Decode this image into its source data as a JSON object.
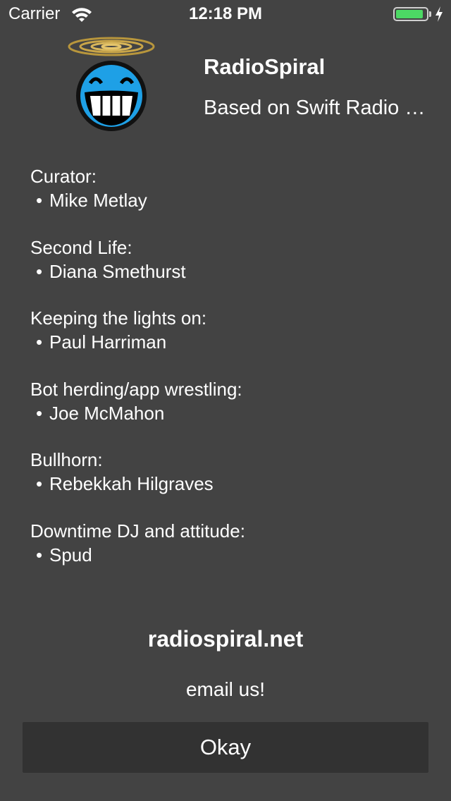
{
  "status_bar": {
    "carrier": "Carrier",
    "time": "12:18 PM",
    "battery_level": 0.9
  },
  "header": {
    "app_name": "RadioSpiral",
    "subtitle": "Based on Swift Radio Pro"
  },
  "credits": [
    {
      "role": "Curator:",
      "person": "Mike Metlay"
    },
    {
      "role": "Second Life:",
      "person": "Diana Smethurst"
    },
    {
      "role": "Keeping the lights on:",
      "person": "Paul Harriman"
    },
    {
      "role": "Bot herding/app wrestling:",
      "person": "Joe McMahon"
    },
    {
      "role": "Bullhorn:",
      "person": "Rebekkah Hilgraves"
    },
    {
      "role": "Downtime DJ and attitude:",
      "person": "Spud"
    }
  ],
  "bullet": "•",
  "links": {
    "website": "radiospiral.net",
    "email": "email us!"
  },
  "okay_label": "Okay",
  "colors": {
    "background": "#434343",
    "button_background": "#323232",
    "text": "#ffffff",
    "battery": "#4cd964",
    "logo_face": "#1ea0e6",
    "halo": "#b8963c"
  }
}
